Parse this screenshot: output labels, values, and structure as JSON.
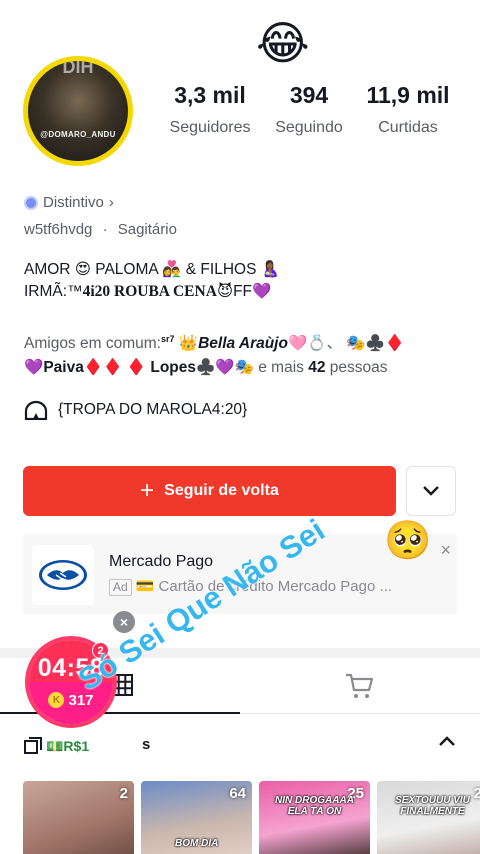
{
  "profile": {
    "avatar_caption": "@DOMARO_ANDU",
    "avatar_top_text": "DIH",
    "header_emoji": "😂",
    "stats": {
      "followers_value": "3,3 mil",
      "followers_label": "Seguidores",
      "following_value": "394",
      "following_label": "Seguindo",
      "likes_value": "11,9 mil",
      "likes_label": "Curtidas"
    },
    "badge_label": "Distintivo",
    "badge_chevron": "›",
    "handle": "w5tf6hvdg",
    "separator": "·",
    "zodiac": "Sagitário",
    "bio_line1": "AMOR 😍 PALOMA 👩‍❤️‍👨 & FILHOS 🤱🏾",
    "bio_line2_prefix": "IRMÃ:™",
    "bio_line2_bold": "4i20 ROUBA CENA",
    "bio_line2_suffix": "😈FF💜"
  },
  "mutual": {
    "prefix": "Amigos em comum:",
    "sup": "sr7",
    "name1_emoji": "👑",
    "name1": "Bella Araùjo",
    "name1_suffix": "🩷💍、 🎭♣️♦️",
    "line2_emoji": "💜",
    "name2": "Paiva",
    "name2_suffix": "♦️♦️ ♦️",
    "name3": "Lopes",
    "name3_suffix": "♣️💜🎭",
    "and_more": "e mais",
    "count": "42",
    "people": "pessoas"
  },
  "group": {
    "label": "{TROPA DO MAROLA4:20}"
  },
  "actions": {
    "follow_plus": "+",
    "follow_label": "Seguir de volta"
  },
  "ad": {
    "title": "Mercado Pago",
    "tag": "Ad",
    "card_emoji": "💳",
    "text": "Cartão de crédito Mercado Pago ...",
    "close": "×",
    "floating_emoji": "🥺",
    "dismiss": "×"
  },
  "live_timer": {
    "time": "04:58",
    "coins": "317",
    "coin_symbol": "K",
    "badge_count": "2"
  },
  "section": {
    "label": "💵R$1",
    "trailing": "s"
  },
  "watermark": {
    "text": "Só Sei Que Não Sei"
  },
  "videos": [
    {
      "count": "2",
      "caption": "",
      "caption2": ""
    },
    {
      "count": "64",
      "caption": "",
      "caption2": "BOM DIA"
    },
    {
      "count": "25",
      "caption": "NIN DROGAAAA ELA TÁ ON",
      "caption2": ""
    },
    {
      "count": "2",
      "caption": "SEXTOUUU VIU FINALMENTE",
      "caption2": ""
    }
  ],
  "colors": {
    "follow_button": "#f0392b",
    "avatar_ring": "#f5d800",
    "timer_top": "#ff3058",
    "timer_bottom": "#ff1f87",
    "watermark": "#36b7f0"
  }
}
